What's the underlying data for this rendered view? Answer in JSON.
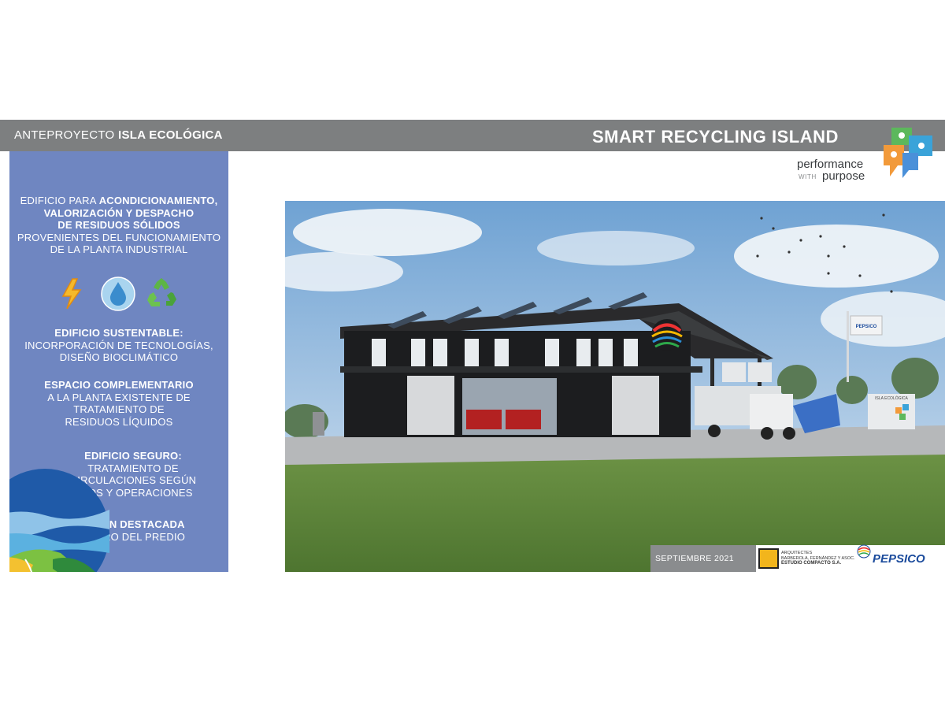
{
  "header": {
    "left_prefix": "ANTEPROYECTO ",
    "left_bold": "ISLA ECOLÓGICA",
    "right_title": "SMART RECYCLING ISLAND"
  },
  "brand": {
    "tagline_performance": "performance",
    "tagline_with": "WITH",
    "tagline_purpose": "purpose"
  },
  "side": {
    "block1": {
      "plain1": "EDIFICIO PARA ",
      "bold1": "ACONDICIONAMIENTO,",
      "bold2": "VALORIZACIÓN  Y DESPACHO",
      "bold3": "DE RESIDUOS  SÓLIDOS",
      "plain2": "PROVENIENTES DEL FUNCIONAMIENTO",
      "plain3": "DE LA  PLANTA INDUSTRIAL"
    },
    "icons": [
      "lightning-icon",
      "water-drop-icon",
      "recycle-icon"
    ],
    "block2": {
      "title": "EDIFICIO SUSTENTABLE:",
      "line1": "INCORPORACIÓN DE TECNOLOGÍAS,",
      "line2": "DISEÑO BIOCLIMÁTICO"
    },
    "block3": {
      "title": "ESPACIO COMPLEMENTARIO",
      "line1": "A LA PLANTA EXISTENTE DE",
      "line2": "TRATAMIENTO DE",
      "line3": "RESIDUOS LÍQUIDOS"
    },
    "block4": {
      "title": "EDIFICIO SEGURO:",
      "line1": "TRATAMIENTO DE",
      "line2": "CIRCULACIONES SEGÚN",
      "line3": "USOS Y OPERACIONES"
    },
    "block5": {
      "title": "IMAGEN DESTACADA",
      "line1": "DENTRO DEL PREDIO"
    }
  },
  "render": {
    "sign_brand": "PEPSICO",
    "sign_small": "ISLA ECOLÓGICA"
  },
  "footer": {
    "date": "SEPTIEMBRE 2021",
    "arch_line1": "ARQUITECTES",
    "arch_line2": "BARBEROLA, FERNÁNDEZ Y ASOC.",
    "arch_line3": "ESTUDIO COMPACTO S.A.",
    "pepsico": "PEPSICO"
  },
  "colors": {
    "header_bar": "#7d7f80",
    "side_panel": "#6f86c1",
    "pepsi_blue": "#1b4b9c",
    "arch_yellow": "#f2b51c"
  }
}
